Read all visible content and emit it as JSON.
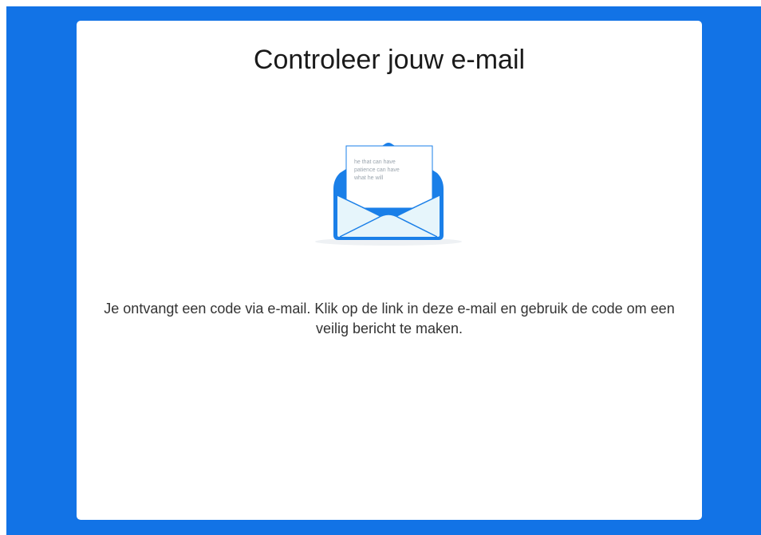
{
  "page": {
    "title": "Controleer jouw e-mail",
    "message": "Je ontvangt een code via e-mail. Klik op de link in deze e-mail en gebruik de code om een veilig bericht te maken."
  },
  "illustration": {
    "icon": "open-envelope-icon",
    "letter_lines": [
      "he that can have",
      "patience can have",
      "what he will"
    ]
  },
  "colors": {
    "background": "#1273e6",
    "card": "#ffffff",
    "envelope_blue": "#1a7fe8",
    "envelope_inner": "#e6f5fb"
  }
}
